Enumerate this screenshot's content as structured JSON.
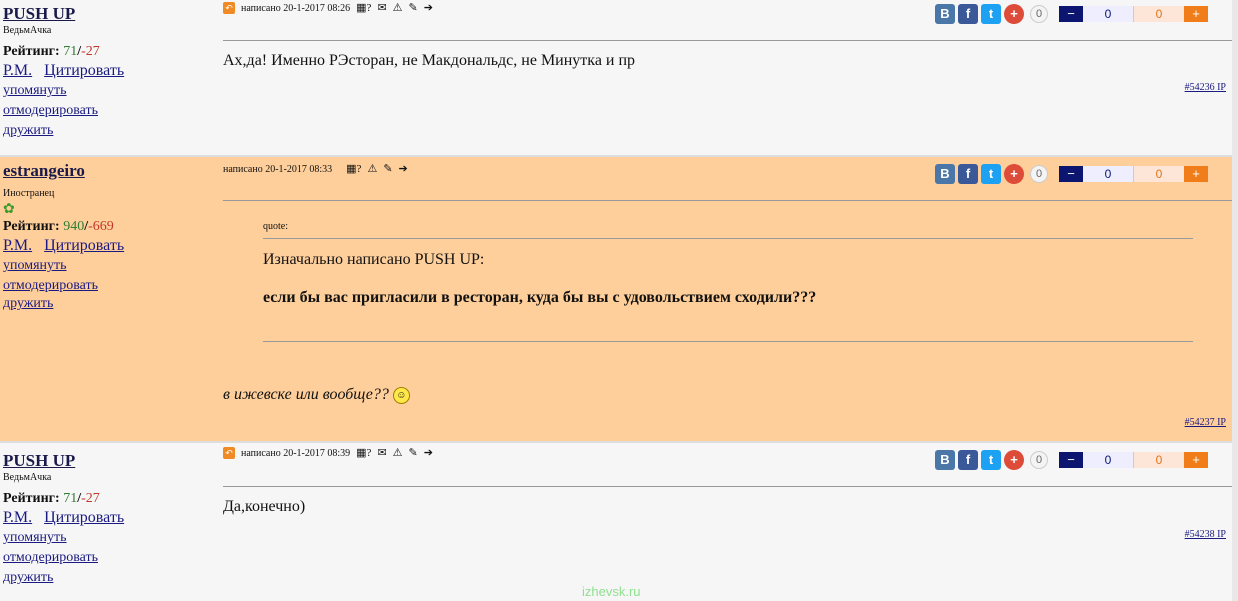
{
  "posts": [
    {
      "username": "PUSH UP",
      "user_title": "ВедьмАчка",
      "rating_label": "Рейтинг:",
      "rating_pos": "71",
      "rating_neg": "-27",
      "pm": "Р.М.",
      "quote_action": "Цитировать",
      "mention": "упомянуть",
      "moderate": "отмодерировать",
      "friend": "дружить",
      "written": "написано 20-1-2017 08:26",
      "text": "Ах,да! Именно РЭсторан, не Макдональдс, не Минутка и пр",
      "share_count": "0",
      "votes_pos": "0",
      "votes_neg": "0",
      "post_id": "#54236",
      "ip": "IP"
    },
    {
      "username": "estrangeiro",
      "user_title": "Иностранец",
      "rating_label": "Рейтинг:",
      "rating_pos": "940",
      "rating_neg": "-669",
      "pm": "Р.М.",
      "quote_action": "Цитировать",
      "mention": "упомянуть",
      "moderate": "отмодерировать",
      "friend": "дружить",
      "written": "написано 20-1-2017 08:33",
      "quote_label": "quote:",
      "quote_author": "Изначально написано PUSH UP:",
      "quote_text": "если бы вас пригласили в ресторан, куда бы вы с удовольствием сходили???",
      "text": "в ижевске или вообще??",
      "share_count": "0",
      "votes_pos": "0",
      "votes_neg": "0",
      "post_id": "#54237",
      "ip": "IP"
    },
    {
      "username": "PUSH UP",
      "user_title": "ВедьмАчка",
      "rating_label": "Рейтинг:",
      "rating_pos": "71",
      "rating_neg": "-27",
      "pm": "Р.М.",
      "quote_action": "Цитировать",
      "mention": "упомянуть",
      "moderate": "отмодерировать",
      "friend": "дружить",
      "written": "написано 20-1-2017 08:39",
      "text": "Да,конечно)",
      "share_count": "0",
      "votes_pos": "0",
      "votes_neg": "0",
      "post_id": "#54238",
      "ip": "IP"
    }
  ],
  "social": {
    "vk": "B",
    "fb": "f",
    "tw": "t",
    "plus": "+"
  },
  "vote": {
    "minus": "−",
    "plus": "+"
  },
  "watermark": "izhevsk.ru",
  "colors": {
    "highlight_bg": "#ffcf9b",
    "vote_minus": "#0c1670",
    "vote_plus": "#f07d1a"
  }
}
